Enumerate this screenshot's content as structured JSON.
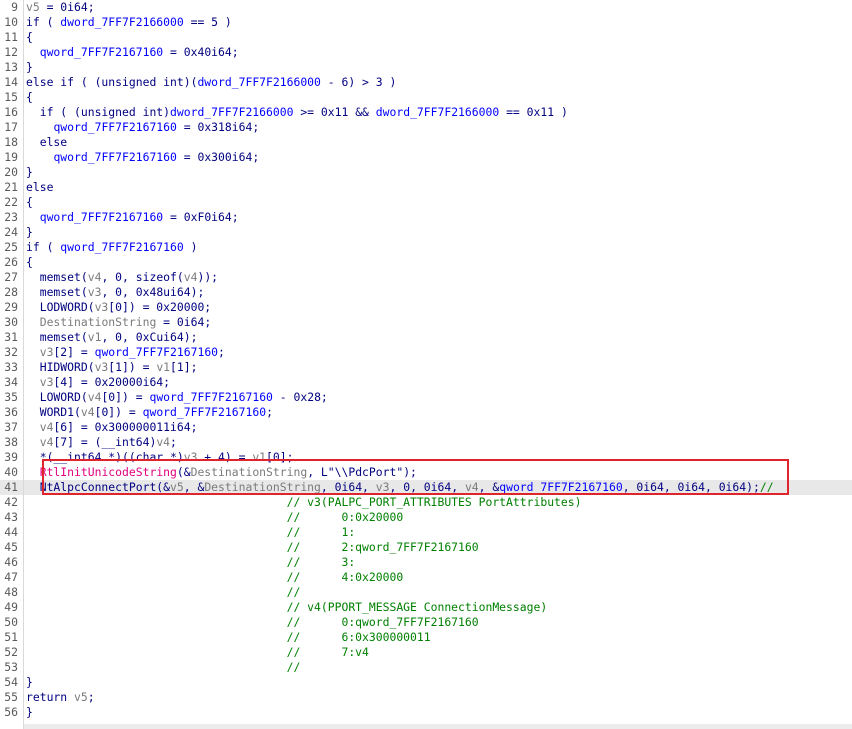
{
  "editor": {
    "highlighted_line": "41",
    "lines": [
      {
        "n": "9",
        "t": [
          [
            "g",
            "v5"
          ],
          [
            "p",
            " = 0i64;"
          ]
        ]
      },
      {
        "n": "10",
        "t": [
          [
            "p",
            "if ( "
          ],
          [
            "b",
            "dword_7FF7F2166000"
          ],
          [
            "p",
            " == 5 )"
          ]
        ]
      },
      {
        "n": "11",
        "t": [
          [
            "p",
            "{"
          ]
        ]
      },
      {
        "n": "12",
        "t": [
          [
            "p",
            "  "
          ],
          [
            "b",
            "qword_7FF7F2167160"
          ],
          [
            "p",
            " = 0x40i64;"
          ]
        ]
      },
      {
        "n": "13",
        "t": [
          [
            "p",
            "}"
          ]
        ]
      },
      {
        "n": "14",
        "t": [
          [
            "p",
            "else if ( (unsigned int)("
          ],
          [
            "b",
            "dword_7FF7F2166000"
          ],
          [
            "p",
            " - 6) > 3 )"
          ]
        ]
      },
      {
        "n": "15",
        "t": [
          [
            "p",
            "{"
          ]
        ]
      },
      {
        "n": "16",
        "t": [
          [
            "p",
            "  if ( (unsigned int)"
          ],
          [
            "b",
            "dword_7FF7F2166000"
          ],
          [
            "p",
            " >= 0x11 && "
          ],
          [
            "b",
            "dword_7FF7F2166000"
          ],
          [
            "p",
            " == 0x11 )"
          ]
        ]
      },
      {
        "n": "17",
        "t": [
          [
            "p",
            "    "
          ],
          [
            "b",
            "qword_7FF7F2167160"
          ],
          [
            "p",
            " = 0x318i64;"
          ]
        ]
      },
      {
        "n": "18",
        "t": [
          [
            "p",
            "  else"
          ]
        ]
      },
      {
        "n": "19",
        "t": [
          [
            "p",
            "    "
          ],
          [
            "b",
            "qword_7FF7F2167160"
          ],
          [
            "p",
            " = 0x300i64;"
          ]
        ]
      },
      {
        "n": "20",
        "t": [
          [
            "p",
            "}"
          ]
        ]
      },
      {
        "n": "21",
        "t": [
          [
            "p",
            "else"
          ]
        ]
      },
      {
        "n": "22",
        "t": [
          [
            "p",
            "{"
          ]
        ]
      },
      {
        "n": "23",
        "t": [
          [
            "p",
            "  "
          ],
          [
            "b",
            "qword_7FF7F2167160"
          ],
          [
            "p",
            " = 0xF0i64;"
          ]
        ]
      },
      {
        "n": "24",
        "t": [
          [
            "p",
            "}"
          ]
        ]
      },
      {
        "n": "25",
        "t": [
          [
            "p",
            "if ( "
          ],
          [
            "b",
            "qword_7FF7F2167160"
          ],
          [
            "p",
            " )"
          ]
        ]
      },
      {
        "n": "26",
        "t": [
          [
            "p",
            "{"
          ]
        ]
      },
      {
        "n": "27",
        "t": [
          [
            "p",
            "  memset("
          ],
          [
            "g",
            "v4"
          ],
          [
            "p",
            ", 0, sizeof("
          ],
          [
            "g",
            "v4"
          ],
          [
            "p",
            "));"
          ]
        ]
      },
      {
        "n": "28",
        "t": [
          [
            "p",
            "  memset("
          ],
          [
            "g",
            "v3"
          ],
          [
            "p",
            ", 0, 0x48ui64);"
          ]
        ]
      },
      {
        "n": "29",
        "t": [
          [
            "p",
            "  LODWORD("
          ],
          [
            "g",
            "v3"
          ],
          [
            "p",
            "[0]) = 0x20000;"
          ]
        ]
      },
      {
        "n": "30",
        "t": [
          [
            "p",
            "  "
          ],
          [
            "g",
            "DestinationString"
          ],
          [
            "p",
            " = 0i64;"
          ]
        ]
      },
      {
        "n": "31",
        "t": [
          [
            "p",
            "  memset("
          ],
          [
            "g",
            "v1"
          ],
          [
            "p",
            ", 0, 0xCui64);"
          ]
        ]
      },
      {
        "n": "32",
        "t": [
          [
            "p",
            "  "
          ],
          [
            "g",
            "v3"
          ],
          [
            "p",
            "[2] = "
          ],
          [
            "b",
            "qword_7FF7F2167160"
          ],
          [
            "p",
            ";"
          ]
        ]
      },
      {
        "n": "33",
        "t": [
          [
            "p",
            "  HIDWORD("
          ],
          [
            "g",
            "v3"
          ],
          [
            "p",
            "[1]) = "
          ],
          [
            "g",
            "v1"
          ],
          [
            "p",
            "[1];"
          ]
        ]
      },
      {
        "n": "34",
        "t": [
          [
            "p",
            "  "
          ],
          [
            "g",
            "v3"
          ],
          [
            "p",
            "[4] = 0x20000i64;"
          ]
        ]
      },
      {
        "n": "35",
        "t": [
          [
            "p",
            "  LOWORD("
          ],
          [
            "g",
            "v4"
          ],
          [
            "p",
            "[0]) = "
          ],
          [
            "b",
            "qword_7FF7F2167160"
          ],
          [
            "p",
            " - 0x28;"
          ]
        ]
      },
      {
        "n": "36",
        "t": [
          [
            "p",
            "  WORD1("
          ],
          [
            "g",
            "v4"
          ],
          [
            "p",
            "[0]) = "
          ],
          [
            "b",
            "qword_7FF7F2167160"
          ],
          [
            "p",
            ";"
          ]
        ]
      },
      {
        "n": "37",
        "t": [
          [
            "p",
            "  "
          ],
          [
            "g",
            "v4"
          ],
          [
            "p",
            "[6] = 0x300000011i64;"
          ]
        ]
      },
      {
        "n": "38",
        "t": [
          [
            "p",
            "  "
          ],
          [
            "g",
            "v4"
          ],
          [
            "p",
            "[7] = (__int64)"
          ],
          [
            "g",
            "v4"
          ],
          [
            "p",
            ";"
          ]
        ]
      },
      {
        "n": "39",
        "t": [
          [
            "p",
            "  *(__int64 *)((char *)"
          ],
          [
            "g",
            "v3"
          ],
          [
            "p",
            " + 4) = "
          ],
          [
            "g",
            "v1"
          ],
          [
            "p",
            "[0];"
          ]
        ]
      },
      {
        "n": "40",
        "t": [
          [
            "p",
            "  "
          ],
          [
            "fn",
            "RtlInitUnicodeString"
          ],
          [
            "p",
            "(&"
          ],
          [
            "g",
            "DestinationString"
          ],
          [
            "p",
            ", L\"\\\\PdcPort\");"
          ]
        ]
      },
      {
        "n": "41",
        "t": [
          [
            "p",
            "  NtAlpcConnectPort(&"
          ],
          [
            "g",
            "v5"
          ],
          [
            "p",
            ", &"
          ],
          [
            "g",
            "DestinationString"
          ],
          [
            "p",
            ", 0i64, "
          ],
          [
            "g",
            "v3"
          ],
          [
            "p",
            ", 0, 0i64, "
          ],
          [
            "g",
            "v4"
          ],
          [
            "p",
            ", &"
          ],
          [
            "b",
            "qword_7FF7F2167160"
          ],
          [
            "p",
            ", 0i64, 0i64, 0i64);"
          ],
          [
            "c",
            "//"
          ]
        ]
      },
      {
        "n": "42",
        "t": [
          [
            "c",
            "                                      // v3(PALPC_PORT_ATTRIBUTES PortAttributes)"
          ]
        ]
      },
      {
        "n": "43",
        "t": [
          [
            "c",
            "                                      //      0:0x20000"
          ]
        ]
      },
      {
        "n": "44",
        "t": [
          [
            "c",
            "                                      //      1:"
          ]
        ]
      },
      {
        "n": "45",
        "t": [
          [
            "c",
            "                                      //      2:qword_7FF7F2167160"
          ]
        ]
      },
      {
        "n": "46",
        "t": [
          [
            "c",
            "                                      //      3:"
          ]
        ]
      },
      {
        "n": "47",
        "t": [
          [
            "c",
            "                                      //      4:0x20000"
          ]
        ]
      },
      {
        "n": "48",
        "t": [
          [
            "c",
            "                                      //"
          ]
        ]
      },
      {
        "n": "49",
        "t": [
          [
            "c",
            "                                      // v4(PPORT_MESSAGE ConnectionMessage)"
          ]
        ]
      },
      {
        "n": "50",
        "t": [
          [
            "c",
            "                                      //      0:qword_7FF7F2167160"
          ]
        ]
      },
      {
        "n": "51",
        "t": [
          [
            "c",
            "                                      //      6:0x300000011"
          ]
        ]
      },
      {
        "n": "52",
        "t": [
          [
            "c",
            "                                      //      7:v4"
          ]
        ]
      },
      {
        "n": "53",
        "t": [
          [
            "c",
            "                                      //"
          ]
        ]
      },
      {
        "n": "54",
        "t": [
          [
            "p",
            "}"
          ]
        ]
      },
      {
        "n": "55",
        "t": [
          [
            "p",
            "return "
          ],
          [
            "g",
            "v5"
          ],
          [
            "p",
            ";"
          ]
        ]
      },
      {
        "n": "56",
        "t": [
          [
            "p",
            "}"
          ]
        ]
      }
    ]
  },
  "colors": {
    "plain": "#000080",
    "variable": "#7b7b7b",
    "global": "#0000ff",
    "comment": "#008000",
    "function_highlight": "#e00080",
    "annotation_box": "#e0242e",
    "highlight_line": "#e8e8e8"
  }
}
